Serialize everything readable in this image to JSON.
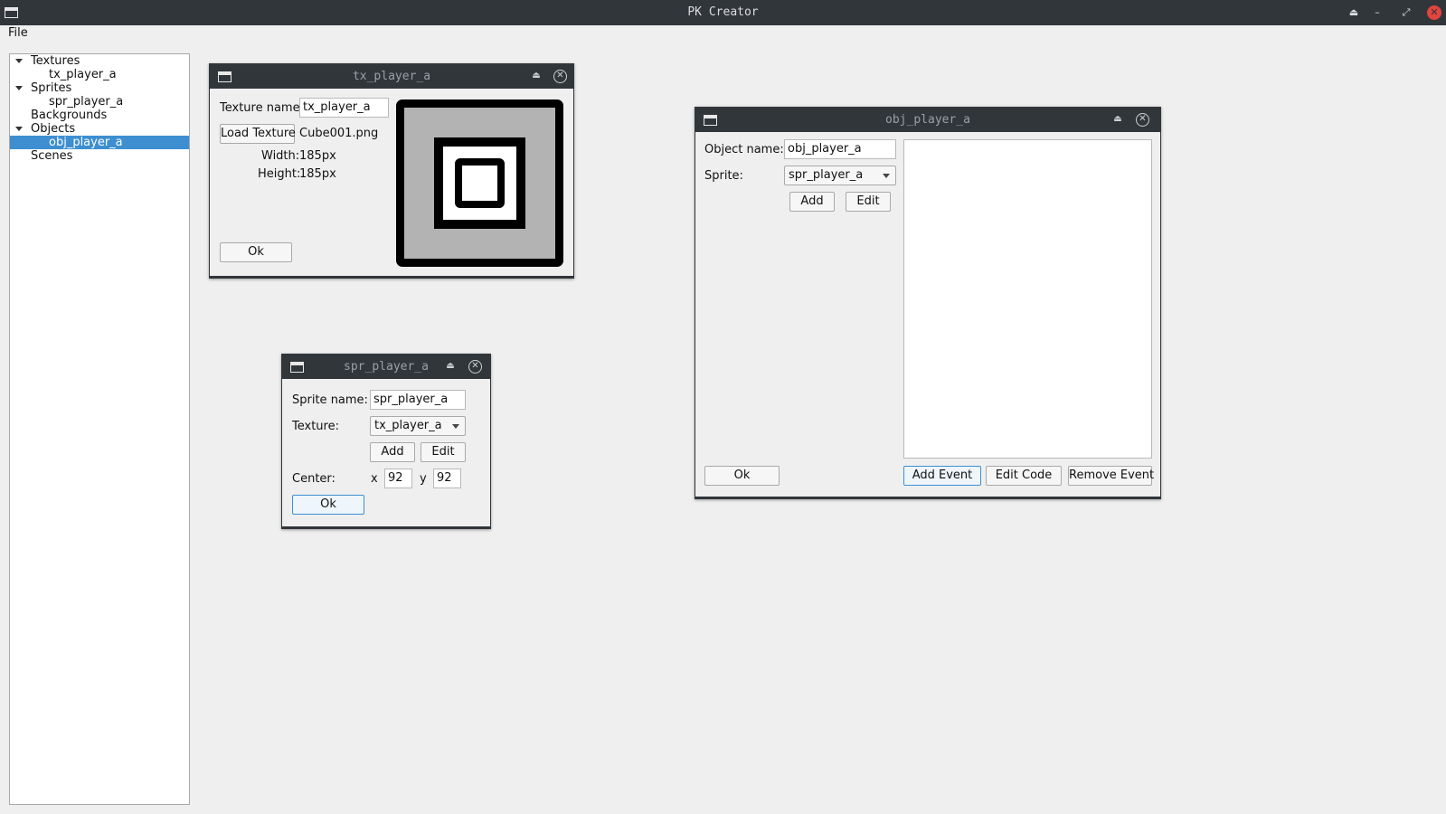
{
  "app": {
    "title": "PK Creator"
  },
  "titlebar_icons": [
    "window-icon",
    "shade-icon",
    "minimize-icon",
    "restore-icon",
    "close-icon"
  ],
  "menu": {
    "file": "File"
  },
  "tree": {
    "items": [
      {
        "label": "Textures",
        "expandable": true
      },
      {
        "label": "tx_player_a",
        "expandable": false
      },
      {
        "label": "Sprites",
        "expandable": true
      },
      {
        "label": "spr_player_a",
        "expandable": false
      },
      {
        "label": "Backgrounds",
        "expandable": false
      },
      {
        "label": "Objects",
        "expandable": true
      },
      {
        "label": "obj_player_a",
        "expandable": false,
        "selected": true
      },
      {
        "label": "Scenes",
        "expandable": false
      }
    ]
  },
  "texture_window": {
    "title": "tx_player_a",
    "name_label": "Texture name:",
    "name_value": "tx_player_a",
    "load_button": "Load Texture",
    "file_name": "Cube001.png",
    "width_label": "Width:",
    "width_value": "185px",
    "height_label": "Height:",
    "height_value": "185px",
    "ok_button": "Ok"
  },
  "sprite_window": {
    "title": "spr_player_a",
    "name_label": "Sprite name:",
    "name_value": "spr_player_a",
    "texture_label": "Texture:",
    "texture_value": "tx_player_a",
    "add_button": "Add",
    "edit_button": "Edit",
    "center_label": "Center:",
    "x_label": "x",
    "x_value": "92",
    "y_label": "y",
    "y_value": "92",
    "ok_button": "Ok"
  },
  "object_window": {
    "title": "obj_player_a",
    "name_label": "Object name:",
    "name_value": "obj_player_a",
    "sprite_label": "Sprite:",
    "sprite_value": "spr_player_a",
    "add_button": "Add",
    "edit_button": "Edit",
    "ok_button": "Ok",
    "add_event_button": "Add Event",
    "edit_code_button": "Edit Code",
    "remove_event_button": "Remove Event"
  },
  "colors": {
    "titlebar": "#31363b",
    "selection": "#3d8fd1",
    "close_red": "#e0453e",
    "background": "#efefef"
  }
}
